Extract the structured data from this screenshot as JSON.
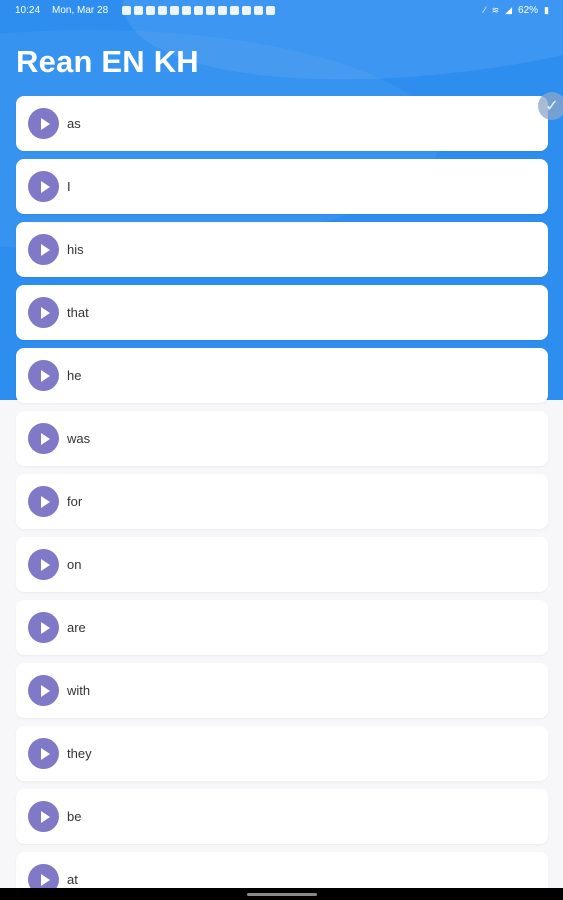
{
  "status_bar": {
    "time": "10:24",
    "date": "Mon, Mar 28",
    "battery": "62%",
    "notification_icons": [
      "minus-circle-icon",
      "facebook-icon",
      "facebook-icon",
      "facebook-icon",
      "download-icon",
      "youtube-icon",
      "mail-icon",
      "x-icon",
      "mail-icon",
      "image-icon",
      "circle-icon",
      "puzzle-icon",
      "cloud-icon"
    ]
  },
  "header": {
    "title": "Rean EN KH"
  },
  "words": [
    "as",
    "I",
    "his",
    "that",
    "he",
    "was",
    "for",
    "on",
    "are",
    "with",
    "they",
    "be",
    "at"
  ],
  "colors": {
    "header_bg": "#2d8ef0",
    "play_button": "#8079c7",
    "page_bg": "#f7f7f9"
  }
}
